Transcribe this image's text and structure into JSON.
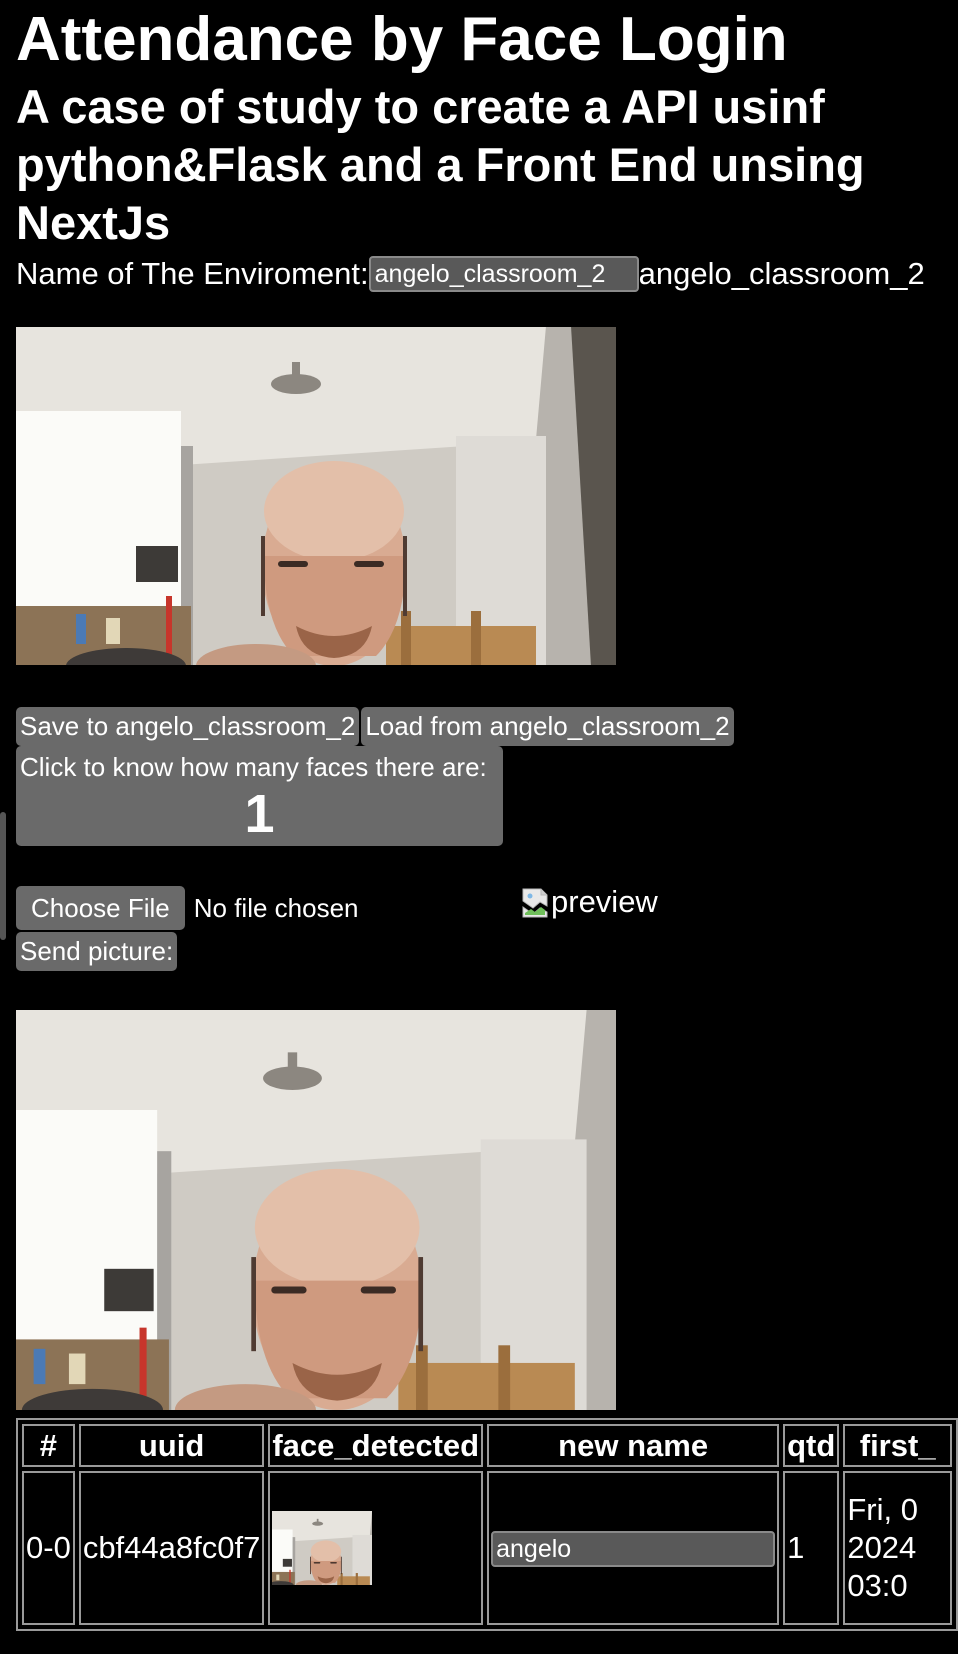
{
  "header": {
    "title": "Attendance by Face Login",
    "subtitle": "A case of study to create a API usinf python&Flask and a Front End unsing NextJs"
  },
  "environment": {
    "label": "Name of The Enviroment:",
    "input_value": "angelo_classroom_2",
    "echo_text": "angelo_classroom_2"
  },
  "actions": {
    "save_label": "Save to angelo_classroom_2",
    "load_label": "Load from angelo_classroom_2",
    "count_label": "Click to know how many faces there are:",
    "count_value": "1"
  },
  "upload": {
    "choose_label": "Choose File",
    "status_text": "No file chosen",
    "preview_alt": "preview",
    "send_label": "Send picture:"
  },
  "table": {
    "headers": [
      "#",
      "uuid",
      "face_detected",
      "new name",
      "qtd",
      "first_"
    ],
    "rows": [
      {
        "index": "0-0",
        "uuid": "cbf44a8fc0f7",
        "new_name": "angelo",
        "qtd": "1",
        "first_seen": "Fri, 0 2024 03:0"
      }
    ]
  },
  "icons": {
    "broken_image": "broken-image-icon"
  }
}
